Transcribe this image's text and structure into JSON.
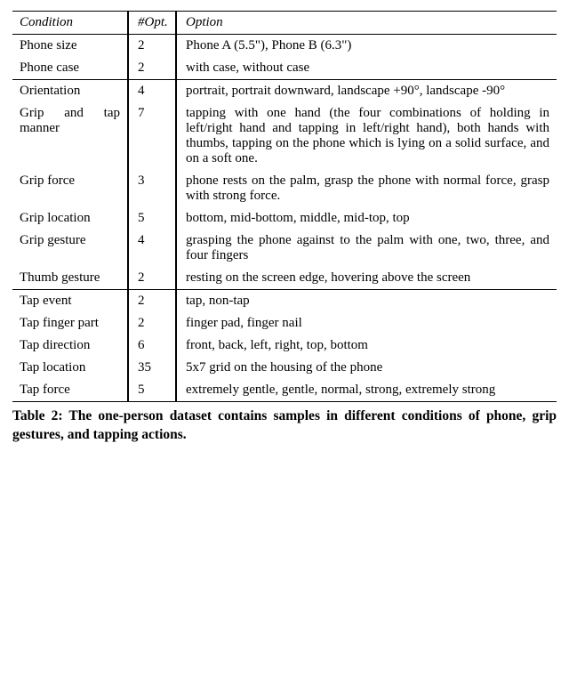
{
  "header": {
    "condition": "Condition",
    "opt": "#Opt.",
    "option": "Option"
  },
  "g1": {
    "r0": {
      "cond": "Phone size",
      "opt": "2",
      "optn": "Phone A (5.5\"), Phone B (6.3\")"
    },
    "r1": {
      "cond": "Phone case",
      "opt": "2",
      "optn": "with case, without case"
    }
  },
  "g2": {
    "r0": {
      "cond": "Orientation",
      "opt": "4",
      "optn": "portrait, portrait downward, landscape +90°, landscape -90°"
    },
    "r1": {
      "cond": "Grip and tap manner",
      "opt": "7",
      "optn": "tapping with one hand (the four combinations of holding in left/right hand and tapping in left/right hand), both hands with thumbs, tapping on the phone which is lying on a solid surface, and on a soft one."
    },
    "r2": {
      "cond": "Grip force",
      "opt": "3",
      "optn": "phone rests on the palm, grasp the phone with normal force, grasp with strong force."
    },
    "r3": {
      "cond": "Grip location",
      "opt": "5",
      "optn": "bottom, mid-bottom, middle, mid-top, top"
    },
    "r4": {
      "cond": "Grip gesture",
      "opt": "4",
      "optn": "grasping the phone against to the palm with one, two, three, and four fingers"
    },
    "r5": {
      "cond": "Thumb gesture",
      "opt": "2",
      "optn": "resting on the screen edge, hovering above the screen"
    }
  },
  "g3": {
    "r0": {
      "cond": "Tap event",
      "opt": "2",
      "optn": "tap, non-tap"
    },
    "r1": {
      "cond": "Tap finger part",
      "opt": "2",
      "optn": "finger pad, finger nail"
    },
    "r2": {
      "cond": "Tap direction",
      "opt": "6",
      "optn": "front, back, left, right, top, bottom"
    },
    "r3": {
      "cond": "Tap location",
      "opt": "35",
      "optn": "5x7 grid on the housing of the phone"
    },
    "r4": {
      "cond": "Tap force",
      "opt": "5",
      "optn": "extremely gentle, gentle, normal, strong, extremely strong"
    }
  },
  "caption": "Table 2: The one-person dataset contains samples in different conditions of phone, grip gestures, and tapping actions."
}
